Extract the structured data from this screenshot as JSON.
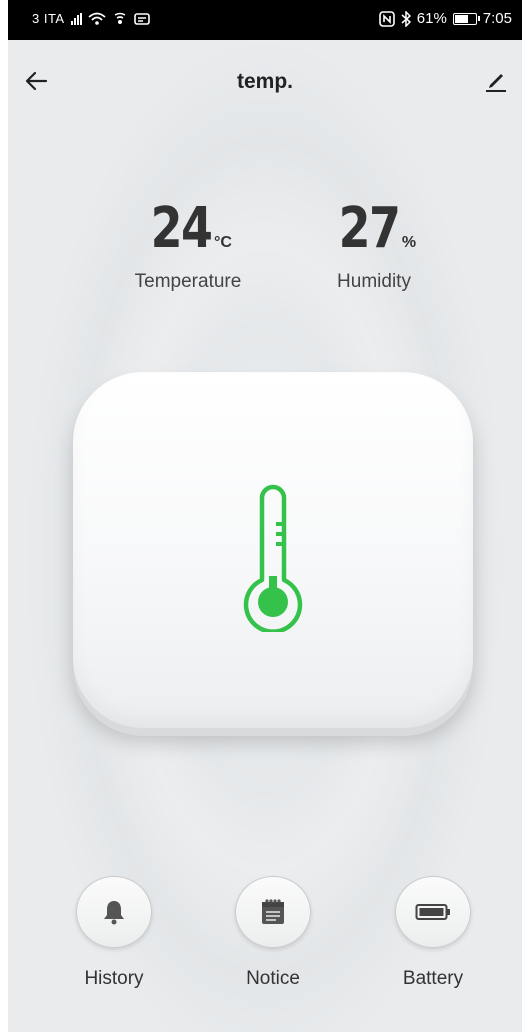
{
  "status_bar": {
    "carrier": "3 ITA",
    "battery_percent": "61%",
    "time": "7:05"
  },
  "header": {
    "title": "temp."
  },
  "readings": {
    "temperature": {
      "value": "24",
      "unit": "°C",
      "label": "Temperature"
    },
    "humidity": {
      "value": "27",
      "unit": "%",
      "label": "Humidity"
    }
  },
  "accent_color": "#35c24a",
  "actions": [
    {
      "label": "History",
      "icon": "bell-icon"
    },
    {
      "label": "Notice",
      "icon": "notepad-icon"
    },
    {
      "label": "Battery",
      "icon": "battery-icon"
    }
  ]
}
